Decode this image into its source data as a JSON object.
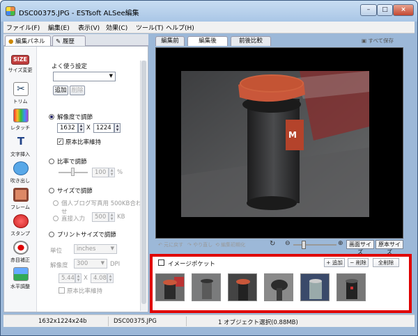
{
  "window": {
    "title": "DSC00375.JPG - ESTsoft ALSee編集",
    "min_label": "–",
    "max_label": "□",
    "close_label": "×"
  },
  "menu": [
    {
      "label": "ファイル(F)"
    },
    {
      "label": "編集(E)"
    },
    {
      "label": "表示(V)"
    },
    {
      "label": "効果(C)"
    },
    {
      "label": "ツール(T)"
    },
    {
      "label": "ヘルプ(H)"
    }
  ],
  "left_tabs": [
    "編集パネル",
    "履歴"
  ],
  "tools": [
    {
      "label": "サイズ変更",
      "icon_text": "SIZE",
      "icon": "size-icon"
    },
    {
      "label": "トリム",
      "icon": "scissors-icon"
    },
    {
      "label": "レタッチ",
      "icon": "retouch-icon"
    },
    {
      "label": "文字挿入",
      "icon": "text-icon",
      "icon_text": "T"
    },
    {
      "label": "吹き出し",
      "icon": "balloon-icon"
    },
    {
      "label": "フレーム",
      "icon": "frame-icon"
    },
    {
      "label": "スタンプ",
      "icon": "stamp-icon"
    },
    {
      "label": "赤目補正",
      "icon": "redeye-icon"
    },
    {
      "label": "水平調整",
      "icon": "level-icon"
    }
  ],
  "options": {
    "favorites_label": "よく使う設定",
    "favorites_value": "",
    "add_label": "追加",
    "delete_label": "削除",
    "resolution_label": "解像度で調節",
    "width": "1632",
    "x_label": "X",
    "height": "1224",
    "keep_ratio_label": "原本比率維持",
    "ratio_label": "比率で調節",
    "ratio_value": "100",
    "ratio_unit": "%",
    "size_label": "サイズで調節",
    "preset_label": "個人ブログ写真用 500KB合わせ",
    "direct_label": "直接入力",
    "direct_value": "500",
    "direct_unit": "KB",
    "print_label": "プリントサイズで調節",
    "unit_label": "単位",
    "unit_value": "inches",
    "dpi_label": "解像度",
    "dpi_value": "300",
    "dpi_unit": "DPI",
    "print_w": "5.44",
    "print_h": "4.08",
    "print_keep_label": "原本比率維持"
  },
  "right_tabs": [
    "編集前",
    "編集後",
    "前後比較"
  ],
  "save_all_label": "すべて保存",
  "controls": {
    "undo_label": "元に戻す",
    "redo_label": "やり直し",
    "reset_label": "編集初期化",
    "fit_label": "画面サイズ",
    "orig_label": "原本サイズ"
  },
  "basket": {
    "title": "イメージポケット",
    "add_label": "+ 追加",
    "remove_label": "− 削除",
    "remove_all_label": "全削除",
    "thumbnail_count": 6
  },
  "status": {
    "dimensions": "1632x1224x24b",
    "filename": "DSC00375.JPG",
    "selection": "1 オブジェクト選択(0.88MB)"
  },
  "colors": {
    "highlight_border": "#e00000",
    "bin_lid": "#c9573a"
  }
}
